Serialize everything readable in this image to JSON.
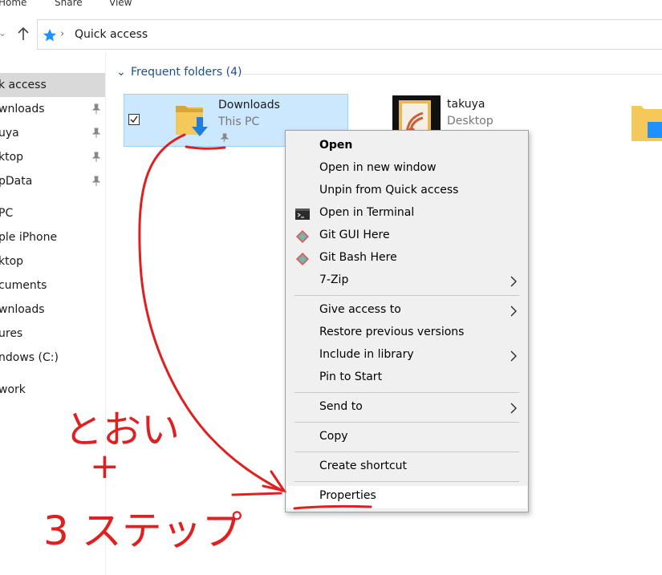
{
  "ribbon": {
    "tabs": [
      "Home",
      "Share",
      "View"
    ]
  },
  "address": {
    "location": "Quick access"
  },
  "sidebar": {
    "items": [
      {
        "label": "k access",
        "pinned": false,
        "selected": true
      },
      {
        "label": "wnloads",
        "pinned": true
      },
      {
        "label": "uya",
        "pinned": true
      },
      {
        "label": "ktop",
        "pinned": true
      },
      {
        "label": "pData",
        "pinned": true
      },
      {
        "label": "PC",
        "pinned": false
      },
      {
        "label": "ple iPhone",
        "pinned": false
      },
      {
        "label": "ktop",
        "pinned": false
      },
      {
        "label": "cuments",
        "pinned": false
      },
      {
        "label": "wnloads",
        "pinned": false
      },
      {
        "label": "ures",
        "pinned": false
      },
      {
        "label": "ndows (C:)",
        "pinned": false
      },
      {
        "label": "work",
        "pinned": false
      }
    ]
  },
  "main": {
    "group_header": "Frequent folders (4)",
    "tiles": [
      {
        "name": "Downloads",
        "location": "This PC"
      },
      {
        "name": "takuya",
        "location": "Desktop"
      }
    ]
  },
  "context_menu": {
    "items": [
      {
        "label": "Open",
        "bold": true
      },
      {
        "label": "Open in new window"
      },
      {
        "label": "Unpin from Quick access"
      },
      {
        "label": "Open in Terminal",
        "icon": "terminal-icon"
      },
      {
        "label": "Git GUI Here",
        "icon": "git-icon"
      },
      {
        "label": "Git Bash Here",
        "icon": "git-icon"
      },
      {
        "label": "7-Zip",
        "submenu": true
      },
      {
        "label": "Give access to",
        "submenu": true
      },
      {
        "label": "Restore previous versions"
      },
      {
        "label": "Include in library",
        "submenu": true
      },
      {
        "label": "Pin to Start"
      },
      {
        "label": "Send to",
        "submenu": true
      },
      {
        "label": "Copy"
      },
      {
        "label": "Create shortcut"
      },
      {
        "label": "Properties",
        "highlighted": true
      }
    ]
  },
  "annotation": {
    "line1": "とおい",
    "line2": "+",
    "line3": "3 ステップ"
  },
  "colors": {
    "selection_bg": "#cce8ff",
    "selection_border": "#99d1ff",
    "accent_blue": "#1e4e8c",
    "annotation_red": "#e02020",
    "menu_bg": "#f0f0f0"
  }
}
